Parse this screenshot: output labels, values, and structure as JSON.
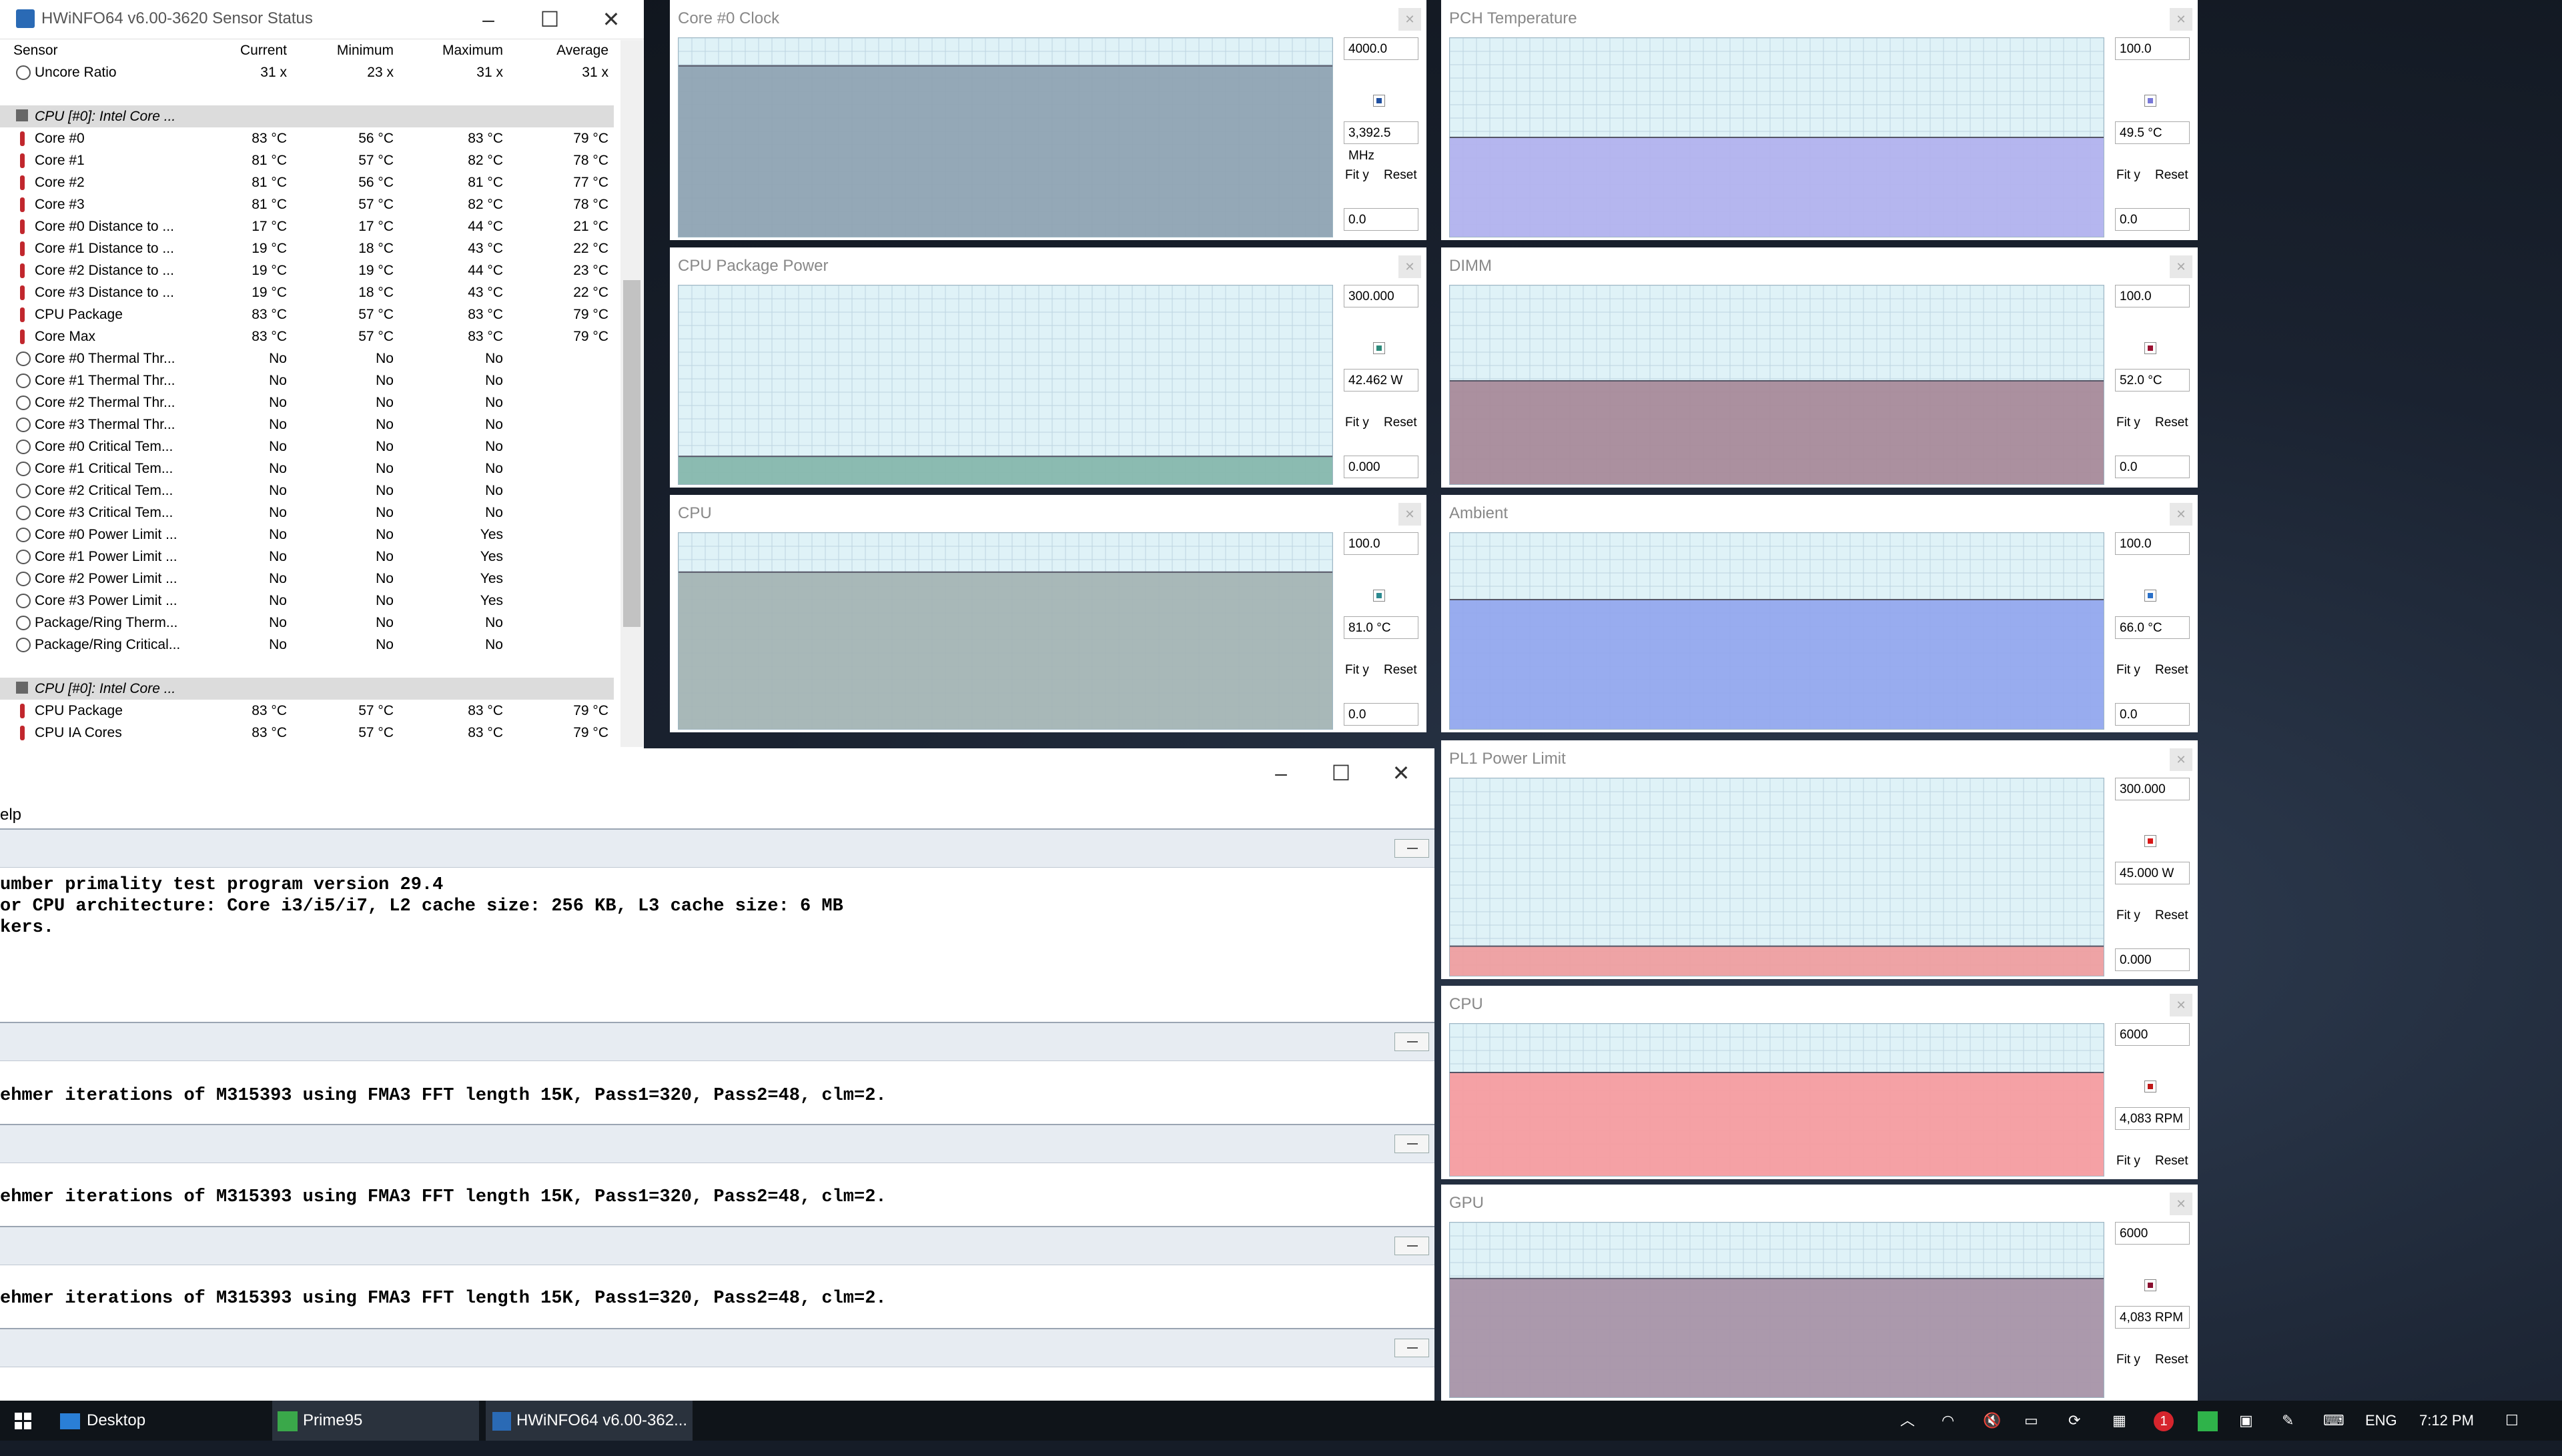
{
  "hwinfo": {
    "title": "HWiNFO64 v6.00-3620 Sensor Status",
    "columns": [
      "Sensor",
      "Current",
      "Minimum",
      "Maximum",
      "Average"
    ],
    "rows": [
      {
        "type": "circle",
        "name": "Uncore Ratio",
        "current": "31 x",
        "minimum": "23 x",
        "maximum": "31 x",
        "average": "31 x"
      },
      {
        "type": "blank"
      },
      {
        "type": "group",
        "name": "CPU [#0]: Intel Core ..."
      },
      {
        "type": "therm",
        "name": "Core #0",
        "current": "83 °C",
        "minimum": "56 °C",
        "maximum": "83 °C",
        "average": "79 °C"
      },
      {
        "type": "therm",
        "name": "Core #1",
        "current": "81 °C",
        "minimum": "57 °C",
        "maximum": "82 °C",
        "average": "78 °C"
      },
      {
        "type": "therm",
        "name": "Core #2",
        "current": "81 °C",
        "minimum": "56 °C",
        "maximum": "81 °C",
        "average": "77 °C"
      },
      {
        "type": "therm",
        "name": "Core #3",
        "current": "81 °C",
        "minimum": "57 °C",
        "maximum": "82 °C",
        "average": "78 °C"
      },
      {
        "type": "therm",
        "name": "Core #0 Distance to ...",
        "current": "17 °C",
        "minimum": "17 °C",
        "maximum": "44 °C",
        "average": "21 °C"
      },
      {
        "type": "therm",
        "name": "Core #1 Distance to ...",
        "current": "19 °C",
        "minimum": "18 °C",
        "maximum": "43 °C",
        "average": "22 °C"
      },
      {
        "type": "therm",
        "name": "Core #2 Distance to ...",
        "current": "19 °C",
        "minimum": "19 °C",
        "maximum": "44 °C",
        "average": "23 °C"
      },
      {
        "type": "therm",
        "name": "Core #3 Distance to ...",
        "current": "19 °C",
        "minimum": "18 °C",
        "maximum": "43 °C",
        "average": "22 °C"
      },
      {
        "type": "therm",
        "name": "CPU Package",
        "current": "83 °C",
        "minimum": "57 °C",
        "maximum": "83 °C",
        "average": "79 °C"
      },
      {
        "type": "therm",
        "name": "Core Max",
        "current": "83 °C",
        "minimum": "57 °C",
        "maximum": "83 °C",
        "average": "79 °C"
      },
      {
        "type": "circle",
        "name": "Core #0 Thermal Thr...",
        "current": "No",
        "minimum": "No",
        "maximum": "No",
        "average": ""
      },
      {
        "type": "circle",
        "name": "Core #1 Thermal Thr...",
        "current": "No",
        "minimum": "No",
        "maximum": "No",
        "average": ""
      },
      {
        "type": "circle",
        "name": "Core #2 Thermal Thr...",
        "current": "No",
        "minimum": "No",
        "maximum": "No",
        "average": ""
      },
      {
        "type": "circle",
        "name": "Core #3 Thermal Thr...",
        "current": "No",
        "minimum": "No",
        "maximum": "No",
        "average": ""
      },
      {
        "type": "circle",
        "name": "Core #0 Critical Tem...",
        "current": "No",
        "minimum": "No",
        "maximum": "No",
        "average": ""
      },
      {
        "type": "circle",
        "name": "Core #1 Critical Tem...",
        "current": "No",
        "minimum": "No",
        "maximum": "No",
        "average": ""
      },
      {
        "type": "circle",
        "name": "Core #2 Critical Tem...",
        "current": "No",
        "minimum": "No",
        "maximum": "No",
        "average": ""
      },
      {
        "type": "circle",
        "name": "Core #3 Critical Tem...",
        "current": "No",
        "minimum": "No",
        "maximum": "No",
        "average": ""
      },
      {
        "type": "circle",
        "name": "Core #0 Power Limit ...",
        "current": "No",
        "minimum": "No",
        "maximum": "Yes",
        "average": ""
      },
      {
        "type": "circle",
        "name": "Core #1 Power Limit ...",
        "current": "No",
        "minimum": "No",
        "maximum": "Yes",
        "average": ""
      },
      {
        "type": "circle",
        "name": "Core #2 Power Limit ...",
        "current": "No",
        "minimum": "No",
        "maximum": "Yes",
        "average": ""
      },
      {
        "type": "circle",
        "name": "Core #3 Power Limit ...",
        "current": "No",
        "minimum": "No",
        "maximum": "Yes",
        "average": ""
      },
      {
        "type": "circle",
        "name": "Package/Ring Therm...",
        "current": "No",
        "minimum": "No",
        "maximum": "No",
        "average": ""
      },
      {
        "type": "circle",
        "name": "Package/Ring Critical...",
        "current": "No",
        "minimum": "No",
        "maximum": "No",
        "average": ""
      },
      {
        "type": "blank"
      },
      {
        "type": "group",
        "name": "CPU [#0]: Intel Core ..."
      },
      {
        "type": "therm",
        "name": "CPU Package",
        "current": "83 °C",
        "minimum": "57 °C",
        "maximum": "83 °C",
        "average": "79 °C"
      },
      {
        "type": "therm",
        "name": "CPU IA Cores",
        "current": "83 °C",
        "minimum": "57 °C",
        "maximum": "83 °C",
        "average": "79 °C"
      }
    ]
  },
  "graphs": [
    {
      "id": "g1",
      "title": "Core #0 Clock",
      "max": "4000.0",
      "current": "3,392.5 MHz",
      "min": "0.0",
      "fit": "Fit y",
      "reset": "Reset",
      "fill": "#8fa3b3",
      "dot": "#1f4fa0",
      "level": 0.86
    },
    {
      "id": "g2",
      "title": "CPU Package Power",
      "max": "300.000",
      "current": "42.462 W",
      "min": "0.000",
      "fit": "Fit y",
      "reset": "Reset",
      "fill": "#86b7ad",
      "dot": "#2c8a7a",
      "level": 0.14
    },
    {
      "id": "g3",
      "title": "CPU",
      "max": "100.0",
      "current": "81.0 °C",
      "min": "0.0",
      "fit": "Fit y",
      "reset": "Reset",
      "fill": "#a4b4b4",
      "dot": "#2c8a90",
      "level": 0.8
    },
    {
      "id": "g4",
      "title": "PCH Temperature",
      "max": "100.0",
      "current": "49.5 °C",
      "min": "0.0",
      "fit": "Fit y",
      "reset": "Reset",
      "fill": "#b2b2ee",
      "dot": "#7878d8",
      "level": 0.5
    },
    {
      "id": "g5",
      "title": "DIMM",
      "max": "100.0",
      "current": "52.0 °C",
      "min": "0.0",
      "fit": "Fit y",
      "reset": "Reset",
      "fill": "#a88a9a",
      "dot": "#9a1030",
      "level": 0.52
    },
    {
      "id": "g6",
      "title": "Ambient",
      "max": "100.0",
      "current": "66.0 °C",
      "min": "0.0",
      "fit": "Fit y",
      "reset": "Reset",
      "fill": "#93a8ee",
      "dot": "#2a70c8",
      "level": 0.66
    },
    {
      "id": "g7",
      "title": "PL1 Power Limit",
      "max": "300.000",
      "current": "45.000 W",
      "min": "0.000",
      "fit": "Fit y",
      "reset": "Reset",
      "fill": "#ee9ea0",
      "dot": "#d81818",
      "level": 0.15
    },
    {
      "id": "g8",
      "title": "CPU",
      "max": "6000",
      "current": "4,083 RPM",
      "min": "",
      "fit": "Fit y",
      "reset": "Reset",
      "fill": "#f59ca0",
      "dot": "#c01818",
      "level": 0.68
    },
    {
      "id": "g9",
      "title": "GPU",
      "max": "6000",
      "current": "4,083 RPM",
      "min": "",
      "fit": "Fit y",
      "reset": "Reset",
      "fill": "#a894a8",
      "dot": "#8a1030",
      "level": 0.68
    }
  ],
  "prime95": {
    "menu_fragment": "elp",
    "pane1": {
      "lines": [
        "umber primality test program version 29.4",
        "or CPU architecture: Core i3/i5/i7, L2 cache size: 256 KB, L3 cache size: 6 MB",
        "kers."
      ]
    },
    "pane_worker_line": "ehmer iterations of M315393 using FMA3 FFT length 15K, Pass1=320, Pass2=48, clm=2."
  },
  "taskbar": {
    "items": [
      {
        "label": "Desktop"
      },
      {
        "label": "Prime95"
      },
      {
        "label": "HWiNFO64 v6.00-362..."
      }
    ],
    "lang": "ENG",
    "time": "7:12 PM",
    "badge": "1"
  }
}
